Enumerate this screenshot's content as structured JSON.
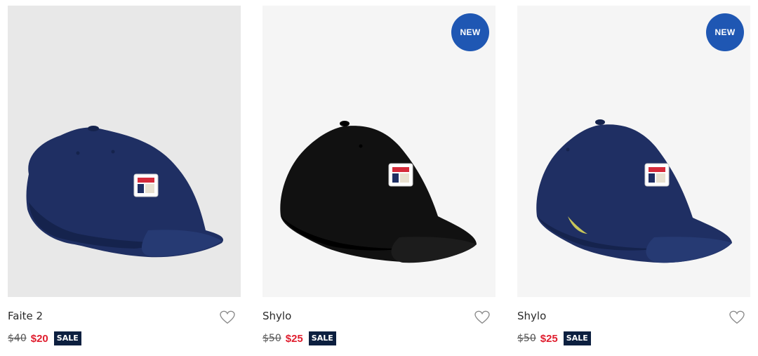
{
  "products": [
    {
      "name": "Faite 2",
      "was_price": "$40",
      "sale_price": "$20",
      "sale_label": "SALE",
      "badge": "",
      "cap_color": "navy",
      "image_bg": "gray",
      "image_alt": ""
    },
    {
      "name": "Shylo",
      "was_price": "$50",
      "sale_price": "$25",
      "sale_label": "SALE",
      "badge": "NEW",
      "cap_color": "black",
      "image_bg": "light",
      "image_alt": ""
    },
    {
      "name": "Shylo",
      "was_price": "$50",
      "sale_price": "$25",
      "sale_label": "SALE",
      "badge": "NEW",
      "cap_color": "navy",
      "image_bg": "light",
      "image_alt": ""
    }
  ],
  "colors": {
    "badge": "#1f57b3",
    "sale_price": "#e01e2f",
    "sale_tag": "#0c1f3f",
    "navy_cap": "#1f2f63",
    "black_cap": "#111111"
  },
  "icons": {
    "wishlist": "heart-outline-icon"
  }
}
